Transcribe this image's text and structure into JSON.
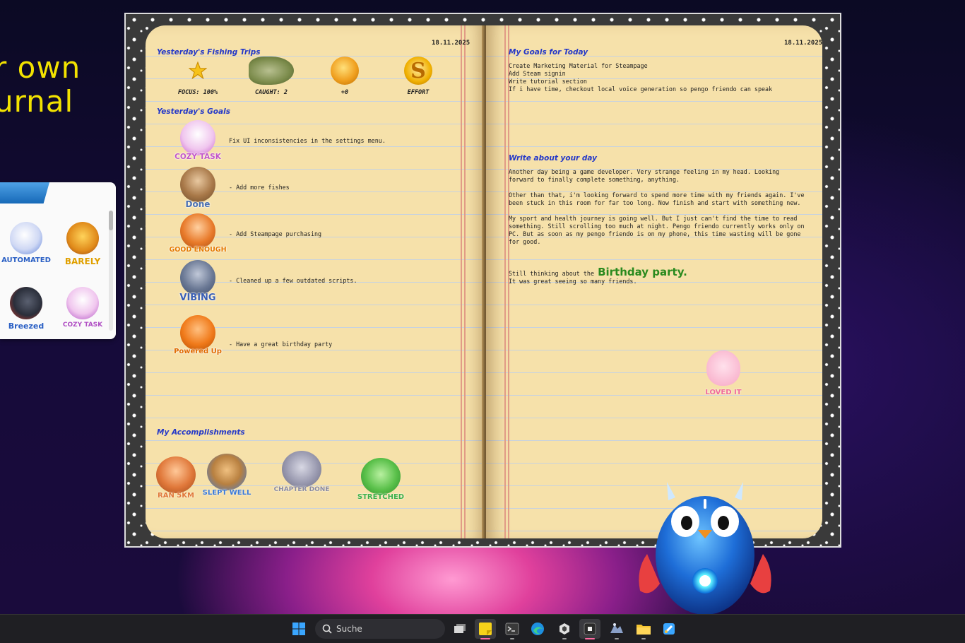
{
  "background": {
    "promo_lines": [
      "r own",
      "urnal"
    ]
  },
  "sticker_panel": {
    "stickers": [
      {
        "label": "AUTOMATED",
        "icon": "bunny-robot-arm-icon",
        "color": "#2a5fc4"
      },
      {
        "label": "BARELY",
        "icon": "tired-fox-icon",
        "color": "#e0a000"
      },
      {
        "label": "Breezed",
        "icon": "cat-hero-icon",
        "color": "#2a5fc4"
      },
      {
        "label": "COZY TASK",
        "icon": "bunny-blanket-icon",
        "color": "#b04fc4"
      }
    ]
  },
  "journal": {
    "left_date": "18.11.2025",
    "right_date": "18.11.2025",
    "fishing": {
      "title": "Yesterday's Fishing Trips",
      "stats": [
        {
          "label": "FOCUS: 100%",
          "icon": "star-icon",
          "color": "#f6c21a"
        },
        {
          "label": "CAUGHT: 2",
          "icon": "fish-icon",
          "color": "#6a8a4a"
        },
        {
          "label": "+0",
          "icon": "coins-icon",
          "color": "#e89a1a"
        },
        {
          "label": "EFFORT",
          "icon": "s-badge-icon",
          "color": "#f0a800"
        }
      ]
    },
    "goals": {
      "title": "Yesterday's Goals",
      "items": [
        {
          "sticker": "COZY TASK",
          "icon": "bunny-blanket-icon",
          "color": "#c256c8",
          "text": "Fix UI inconsistencies in the settings menu."
        },
        {
          "sticker": "Done",
          "icon": "otter-icon",
          "color": "#4a6fb0",
          "text": "- Add more fishes"
        },
        {
          "sticker": "GOOD ENOUGH",
          "icon": "red-panda-icon",
          "color": "#e57a00",
          "text": "- Add Steampage purchasing"
        },
        {
          "sticker": "VIBING",
          "icon": "cat-headphones-icon",
          "color": "#3a5fb4",
          "text": "- Cleaned up a few outdated scripts."
        },
        {
          "sticker": "Powered Up",
          "icon": "squirrel-icon",
          "color": "#e06a00",
          "text": "- Have a great birthday party"
        }
      ]
    },
    "accomplishments": {
      "title": "My Accomplishments",
      "items": [
        {
          "label": "RAN 5KM",
          "icon": "fox-running-icon",
          "color": "#e0783a"
        },
        {
          "label": "SLEPT WELL",
          "icon": "bear-moon-icon",
          "color": "#3a7ad8"
        },
        {
          "label": "CHAPTER DONE",
          "icon": "rat-book-icon",
          "color": "#8a8aa0"
        },
        {
          "label": "STRETCHED",
          "icon": "frog-icon",
          "color": "#3fb04a"
        }
      ]
    },
    "today": {
      "title": "My Goals for Today",
      "items": [
        "Create Marketing Material for Steampage",
        "Add Steam signin",
        "Write tutorial section",
        "If i have time, checkout local voice generation so pengo friendo can speak"
      ]
    },
    "write": {
      "title": "Write about your day",
      "p1": "Another day being a game developer. Very strange feeling in my head. Looking forward to finally complete something, anything.",
      "p2": "Other than that, i'm looking forward to spend more time with my friends again. I've been stuck in this room for far too long. Now finish and start with something new.",
      "p3": "My sport and health journey is going well. But I just can't find the time to read something. Still scrolling too much at night. Pengo friendo currently works only on PC. But as soon as my pengo friendo is on my phone, this time wasting will be gone for good.",
      "p4_prefix": "Still thinking about the",
      "p4_highlight": "Birthday party.",
      "p4_highlight_color": "#2a8a1e",
      "p5": "It was great seeing so many friends."
    },
    "loved_sticker": {
      "label": "LOVED IT",
      "icon": "bunny-hearts-icon",
      "color": "#f06a9a"
    }
  },
  "taskbar": {
    "search_placeholder": "Suche",
    "apps": [
      {
        "name": "start",
        "icon": "windows-start-icon"
      },
      {
        "name": "task-view",
        "icon": "task-view-icon"
      },
      {
        "name": "sticky-notes",
        "icon": "sticky-notes-icon"
      },
      {
        "name": "terminal",
        "icon": "terminal-icon"
      },
      {
        "name": "edge",
        "icon": "edge-browser-icon"
      },
      {
        "name": "unity",
        "icon": "unity-icon"
      },
      {
        "name": "app-dark",
        "icon": "dark-app-icon"
      },
      {
        "name": "dev-tool",
        "icon": "dev-tool-icon"
      },
      {
        "name": "file-explorer",
        "icon": "file-explorer-icon"
      },
      {
        "name": "paint",
        "icon": "paint-icon"
      }
    ]
  }
}
